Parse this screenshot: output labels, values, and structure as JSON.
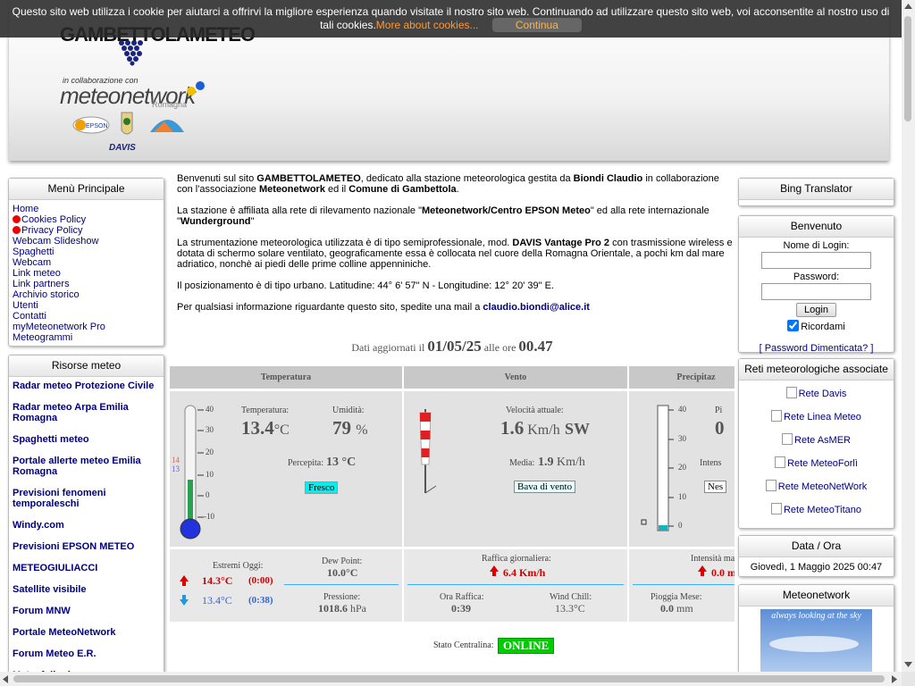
{
  "cookie": {
    "text_line1": "Questo sito web utilizza i cookie per aiutarci a offrirvi la migliore esperienza quando visitate il nostro sito web. Continuando ad utilizzare questo sito web, voi acconsentite al nostro uso di",
    "text_line2": "tali cookies.",
    "more_link": "More about cookies...",
    "continue_button": "Continua"
  },
  "header": {
    "logo_text": "GAMBETTOLAMETEO",
    "collab_text": "in collaborazione con",
    "meteonetwork_text": "meteonetwork",
    "romagna_text": "Romagna",
    "davis_text": "DAVIS"
  },
  "menu": {
    "title": "Menù Principale",
    "items": [
      "Home",
      "Cookies Policy",
      "Privacy Policy",
      "Webcam Slideshow",
      "Spaghetti",
      "Webcam",
      "Link meteo",
      "Link partners",
      "Archivio storico",
      "Utenti",
      "Contatti",
      "myMeteonetwork Pro",
      "Meteogrammi"
    ]
  },
  "resources": {
    "title": "Risorse meteo",
    "items": [
      "Radar meteo Protezione Civile",
      "Radar meteo Arpa Emilia Romagna",
      "Spaghetti meteo",
      "Portale allerte meteo Emilia Romagna",
      "Previsioni fenomeni temporaleschi",
      "Windy.com",
      "Previsioni EPSON METEO",
      "METEOGIULIACCI",
      "Satellite visibile",
      "Forum MNW",
      "Portale MeteoNetwork",
      "Forum Meteo E.R.",
      "Meteofollonica"
    ]
  },
  "intro": {
    "p1_a": "Benvenuti sul sito ",
    "p1_b": "GAMBETTOLAMETEO",
    "p1_c": ", dedicato alla stazione meteorologica gestita da ",
    "p1_d": "Biondi Claudio",
    "p1_e": " in collaborazione con l'associazione ",
    "p1_f": "Meteonetwork",
    "p1_g": " ed il ",
    "p1_h": "Comune di Gambettola",
    "p1_i": ".",
    "p2_a": "La stazione è affiliata alla rete di rilevamento nazionale \"",
    "p2_b": "Meteonetwork/Centro EPSON Meteo",
    "p2_c": "\" ed alla rete internazionale \"",
    "p2_d": "Wunderground",
    "p2_e": "\"",
    "p3_a": "La strumentazione meteorologica utilizzata è di tipo semiprofessionale, mod. ",
    "p3_b": "DAVIS Vantage Pro 2",
    "p3_c": " con trasmissione wireless e dotata di schermo solare ventilato, geograficamente essa è collocata nel cuore della Romagna Orientale, a pochi km dal mare adriatico, nonchè ai piedi delle prime colline appenniniche.",
    "p4": "Il posizionamento è di tipo urbano. Latitudine: 44° 6' 57\" N - Longitudine: 12° 20' 39\" E.",
    "p5_a": "Per qualsiasi informazione riguardante questo sito, spedite una mail a ",
    "p5_b": "claudio.biondi@alice.it"
  },
  "updated": {
    "prefix": "Dati aggiornati il",
    "date": "01/05/25",
    "mid": "alle ore",
    "time": "00.47"
  },
  "station": {
    "col_temp": "Temperatura",
    "col_wind": "Vento",
    "col_prec": "Precipitaz",
    "temp_label": "Temperatura:",
    "temp_value": "13.4",
    "temp_unit": "°C",
    "hum_label": "Umidità:",
    "hum_value": "79",
    "hum_unit": "%",
    "perc_label": "Percepita:",
    "perc_value": "13 °C",
    "temp_tag": "Fresco",
    "thermo_scale": [
      "40",
      "30",
      "20",
      "10",
      "0",
      "-10"
    ],
    "thermo_max": "14",
    "thermo_min": "13",
    "wind_label": "Velocità attuale:",
    "wind_value": "1.6",
    "wind_unit": "Km/h",
    "wind_dir": "SW",
    "avg_label": "Media:",
    "avg_value": "1.9",
    "avg_unit": "Km/h",
    "wind_tag": "Bava di vento",
    "rain_scale": [
      "40",
      "30",
      "20",
      "10",
      "0"
    ],
    "rain_p": "Pi",
    "rain_zero": "0",
    "rain_int": "Intens",
    "rain_tag": "Nes",
    "ext_label": "Estremi Oggi:",
    "tmax": "14.3°C",
    "tmax_time": "(0:00)",
    "tmin": "13.4°C",
    "tmin_time": "(0:38)",
    "dew_label": "Dew Point:",
    "dew_value": "10.0°C",
    "press_label": "Pressione:",
    "press_value": "1018.6",
    "press_unit": "hPa",
    "gust_label": "Raffica giornaliera:",
    "gust_value": "6.4 Km/h",
    "gust_time_label": "Ora Raffica:",
    "gust_time": "0:39",
    "chill_label": "Wind Chill:",
    "chill_value": "13.3°C",
    "int_max_label": "Intensità ma",
    "int_max_value": "0.0 m",
    "rain_month_label": "Pioggia Mese:",
    "rain_month_value": "0.0",
    "rain_month_unit": "mm",
    "status_label": "Stato Centralina:",
    "status_value": "ONLINE"
  },
  "bing": {
    "title": "Bing Translator"
  },
  "login": {
    "title": "Benvenuto",
    "user_label": "Nome di Login:",
    "pass_label": "Password:",
    "button": "Login",
    "remember": "Ricordami",
    "forgot": "[ Password Dimenticata? ]"
  },
  "reti": {
    "title": "Reti meteorologiche associate",
    "items": [
      "Rete Davis",
      "Rete Linea Meteo",
      "Rete AsMER",
      "Rete MeteoForlì",
      "Rete MeteoNetWork",
      "Rete MeteoTitano"
    ]
  },
  "datetime": {
    "title": "Data / Ora",
    "value": "Giovedì, 1 Maggio 2025 00:47"
  },
  "mnw": {
    "title": "Meteonetwork",
    "banner_text": "always looking at the sky"
  },
  "colors": {
    "online": "#00cc00",
    "max_red": "#cc0000",
    "min_blue": "#3366cc",
    "link": "#000080",
    "cookie_link": "#ff9933"
  }
}
